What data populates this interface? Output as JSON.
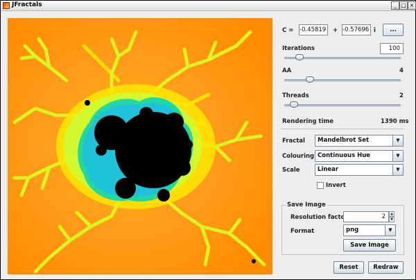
{
  "window": {
    "title": "JFractals",
    "controls": {
      "minimize": "_",
      "maximize": "□",
      "close": "×"
    }
  },
  "c_param": {
    "label": "C =",
    "real": "-0.45819",
    "plus": "+",
    "imag": "-0.57696",
    "unit": "i",
    "pick_button": "..."
  },
  "iterations": {
    "label": "Iterations",
    "value": "100",
    "slider_fraction": 0.1
  },
  "aa": {
    "label": "AA",
    "value": "4",
    "slider_fraction": 0.2
  },
  "threads": {
    "label": "Threads",
    "value": "2",
    "slider_fraction": 0.05
  },
  "rendering": {
    "label": "Rendering time",
    "value": "1390 ms"
  },
  "fractal": {
    "label": "Fractal",
    "selected": "Mandelbrot Set"
  },
  "colouring": {
    "label": "Colouring",
    "selected": "Continuous Hue"
  },
  "scale": {
    "label": "Scale",
    "selected": "Linear"
  },
  "invert": {
    "label": "Invert",
    "checked": false
  },
  "save_image": {
    "group_title": "Save Image",
    "resolution_label": "Resolution factor",
    "resolution_value": "2",
    "format_label": "Format",
    "format_selected": "png",
    "save_button": "Save Image"
  },
  "buttons": {
    "reset": "Reset",
    "redraw": "Redraw"
  },
  "colors": {
    "fractal_outer": "#f6a31f",
    "fractal_band": "#ffe600",
    "fractal_edge": "#2bdc8a",
    "fractal_inner": "#000000"
  }
}
